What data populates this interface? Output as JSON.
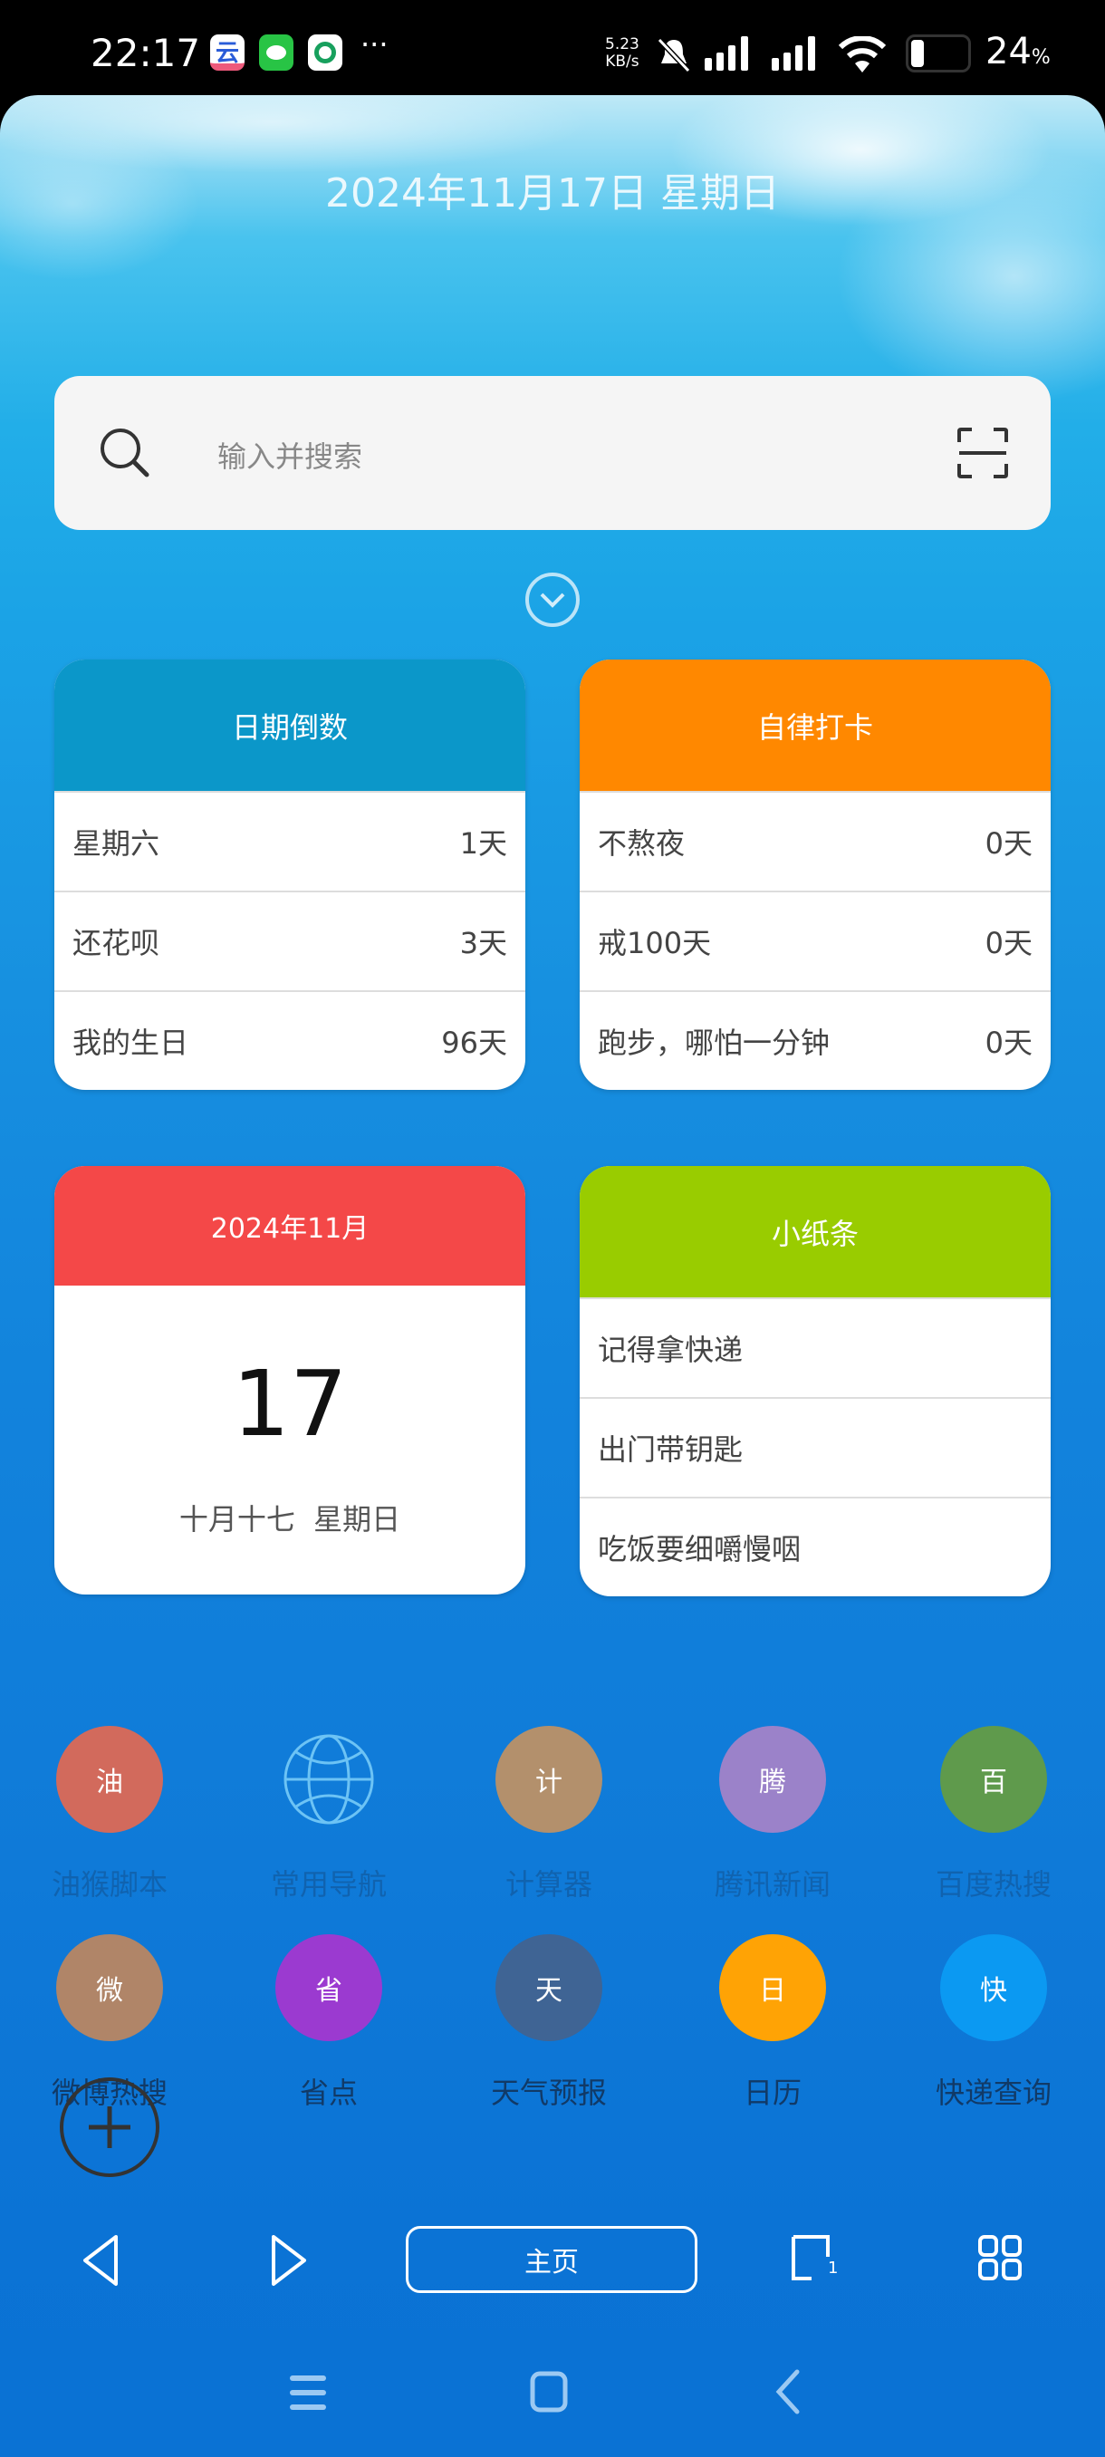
{
  "status_bar": {
    "time": "22:17",
    "net_speed_value": "5.23",
    "net_speed_unit": "KB/s",
    "battery": "24",
    "battery_unit": "%",
    "notification_icons": [
      "ai-app-icon",
      "wechat-icon",
      "green-app-icon"
    ],
    "more": "···"
  },
  "date_header": "2024年11月17日 星期日",
  "search": {
    "placeholder": "输入并搜索"
  },
  "countdown": {
    "title": "日期倒数",
    "color": "#0b97c9",
    "items": [
      {
        "label": "星期六",
        "value": "1天"
      },
      {
        "label": "还花呗",
        "value": "3天"
      },
      {
        "label": "我的生日",
        "value": "96天"
      }
    ]
  },
  "checkin": {
    "title": "自律打卡",
    "color": "#ff8800",
    "items": [
      {
        "label": "不熬夜",
        "value": "0天"
      },
      {
        "label": "戒100天",
        "value": "0天"
      },
      {
        "label": "跑步，哪怕一分钟",
        "value": "0天"
      }
    ]
  },
  "calendar": {
    "month": "2024年11月",
    "day": "17",
    "lunar": "十月十七",
    "weekday": "星期日",
    "color": "#f44848"
  },
  "notes": {
    "title": "小纸条",
    "color": "#99cc00",
    "items": [
      "记得拿快递",
      "出门带钥匙",
      "吃饭要细嚼慢咽"
    ]
  },
  "apps": [
    {
      "glyph": "油",
      "label": "油猴脚本",
      "color": "#d26a5c"
    },
    {
      "glyph": "",
      "label": "常用导航",
      "color": "globe-icon"
    },
    {
      "glyph": "计",
      "label": "计算器",
      "color": "#b3906c"
    },
    {
      "glyph": "腾",
      "label": "腾讯新闻",
      "color": "#9b82c9"
    },
    {
      "glyph": "百",
      "label": "百度热搜",
      "color": "#5f9a4c"
    },
    {
      "glyph": "微",
      "label": "微博热搜",
      "color": "#b08568"
    },
    {
      "glyph": "省",
      "label": "省点",
      "color": "#9b3ad0"
    },
    {
      "glyph": "天",
      "label": "天气预报",
      "color": "#3f6494"
    },
    {
      "glyph": "日",
      "label": "日历",
      "color": "#ffa305"
    },
    {
      "glyph": "快",
      "label": "快递查询",
      "color": "#0b99f2"
    }
  ],
  "toolbar": {
    "home": "主页",
    "tab_count": "1"
  }
}
